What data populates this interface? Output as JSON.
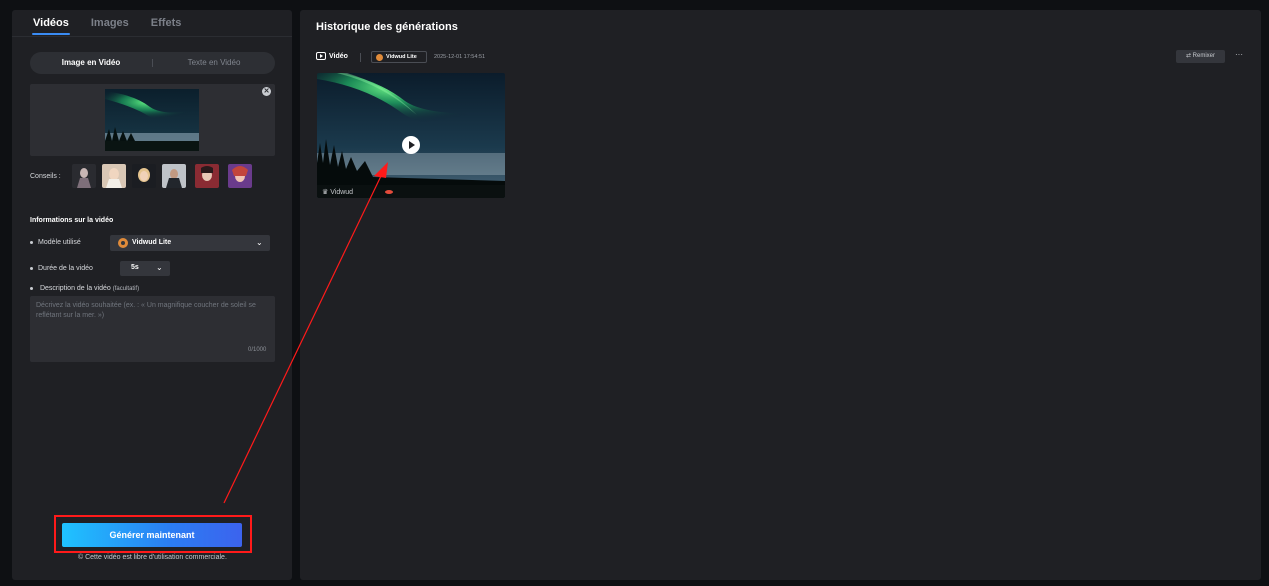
{
  "left_panel": {
    "tabs": [
      {
        "label": "Vidéos",
        "active": true
      },
      {
        "label": "Images",
        "active": false
      },
      {
        "label": "Effets",
        "active": false
      }
    ],
    "segmented": {
      "options": [
        {
          "label": "Image en Vidéo",
          "active": true
        },
        {
          "label": "Texte en Vidéo",
          "active": false
        }
      ]
    },
    "tips_label": "Conseils :",
    "info_title": "Informations sur la vidéo",
    "model": {
      "label": "Modèle utilisé",
      "value": "Vidwud Lite"
    },
    "duration": {
      "label": "Durée de la vidéo",
      "value": "5s"
    },
    "description": {
      "label": "Description de la vidéo",
      "optional": "(facultatif)",
      "placeholder": "Décrivez la vidéo souhaitée (ex. : « Un magnifique coucher de soleil se reflétant sur la mer. »)",
      "counter": "0/1000"
    },
    "generate_label": "Générer maintenant",
    "license_text": "© Cette vidéo est libre d'utilisation commerciale."
  },
  "right_panel": {
    "title": "Historique des générations",
    "entry": {
      "type_label": "Vidéo",
      "model_chip": "Vidwud Lite",
      "timestamp": "2025-12-01 17:54:51",
      "remix_label": "Remixer",
      "more_label": "···",
      "watermark": "Vidwud"
    }
  },
  "colors": {
    "panel_bg": "#1f2024",
    "page_bg": "#0e1013",
    "accent_tab": "#3a8cf4",
    "button_gradient_start": "#1fc3ff",
    "button_gradient_end": "#3c63ee",
    "highlight_red": "#ff1a1a",
    "model_logo": "#e08b3a"
  },
  "icons": [
    "close-icon",
    "chevron-down-icon",
    "video-icon",
    "play-icon",
    "remix-icon",
    "more-icon",
    "crown-icon"
  ]
}
